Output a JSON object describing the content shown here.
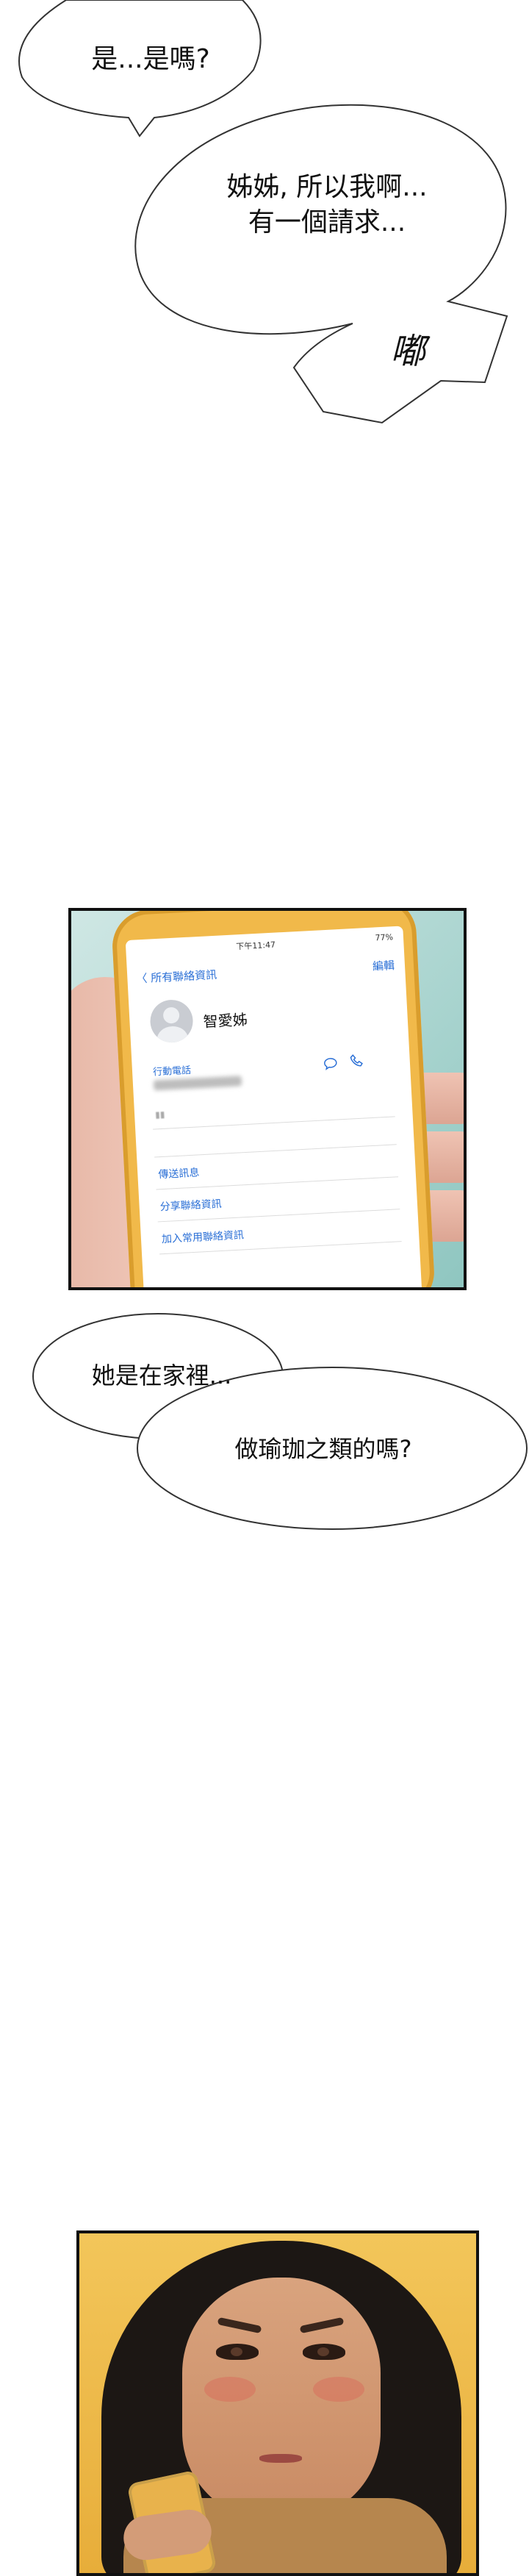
{
  "bubbles": {
    "b1": {
      "line1": "是...是嗎?"
    },
    "b2": {
      "line1": "姊姊, 所以我啊...",
      "line2": "有一個請求..."
    },
    "b3": {
      "sfx": "嘟"
    },
    "b4": {
      "line1": "她是在家裡..."
    },
    "b5": {
      "line1": "做瑜珈之類的嗎?"
    }
  },
  "phone": {
    "status_time": "下午11:47",
    "battery": "77%",
    "back_label": "〈 所有聯絡資訊",
    "edit_label": "編輯",
    "contact_name": "智愛姊",
    "mobile_label": "行動電話",
    "actions": [
      "傳送訊息",
      "分享聯絡資訊",
      "加入常用聯絡資訊"
    ]
  },
  "colors": {
    "ios_blue": "#2a6fd6",
    "phone_gold": "#f1b94a",
    "panel_bg": "#a9d4cf"
  }
}
